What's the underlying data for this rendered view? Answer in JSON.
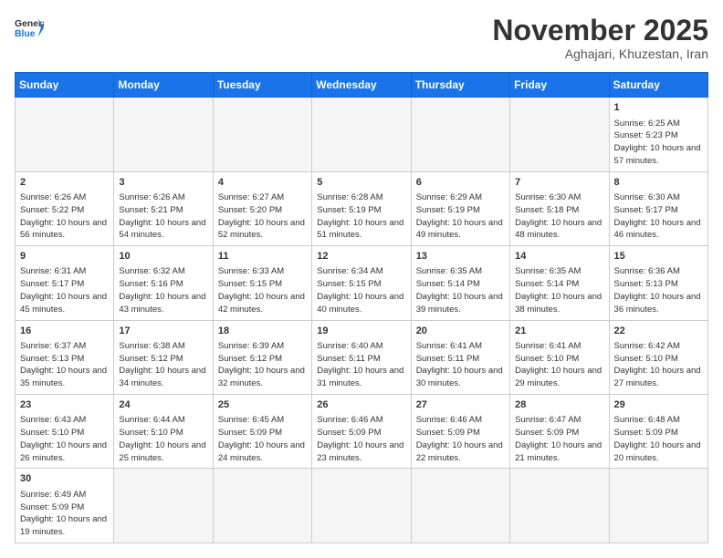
{
  "header": {
    "logo_general": "General",
    "logo_blue": "Blue",
    "month": "November 2025",
    "location": "Aghajari, Khuzestan, Iran"
  },
  "weekdays": [
    "Sunday",
    "Monday",
    "Tuesday",
    "Wednesday",
    "Thursday",
    "Friday",
    "Saturday"
  ],
  "rows": [
    [
      {
        "day": "",
        "info": ""
      },
      {
        "day": "",
        "info": ""
      },
      {
        "day": "",
        "info": ""
      },
      {
        "day": "",
        "info": ""
      },
      {
        "day": "",
        "info": ""
      },
      {
        "day": "",
        "info": ""
      },
      {
        "day": "1",
        "info": "Sunrise: 6:25 AM\nSunset: 5:23 PM\nDaylight: 10 hours\nand 57 minutes."
      }
    ],
    [
      {
        "day": "2",
        "info": "Sunrise: 6:26 AM\nSunset: 5:22 PM\nDaylight: 10 hours\nand 56 minutes."
      },
      {
        "day": "3",
        "info": "Sunrise: 6:26 AM\nSunset: 5:21 PM\nDaylight: 10 hours\nand 54 minutes."
      },
      {
        "day": "4",
        "info": "Sunrise: 6:27 AM\nSunset: 5:20 PM\nDaylight: 10 hours\nand 52 minutes."
      },
      {
        "day": "5",
        "info": "Sunrise: 6:28 AM\nSunset: 5:19 PM\nDaylight: 10 hours\nand 51 minutes."
      },
      {
        "day": "6",
        "info": "Sunrise: 6:29 AM\nSunset: 5:19 PM\nDaylight: 10 hours\nand 49 minutes."
      },
      {
        "day": "7",
        "info": "Sunrise: 6:30 AM\nSunset: 5:18 PM\nDaylight: 10 hours\nand 48 minutes."
      },
      {
        "day": "8",
        "info": "Sunrise: 6:30 AM\nSunset: 5:17 PM\nDaylight: 10 hours\nand 46 minutes."
      }
    ],
    [
      {
        "day": "9",
        "info": "Sunrise: 6:31 AM\nSunset: 5:17 PM\nDaylight: 10 hours\nand 45 minutes."
      },
      {
        "day": "10",
        "info": "Sunrise: 6:32 AM\nSunset: 5:16 PM\nDaylight: 10 hours\nand 43 minutes."
      },
      {
        "day": "11",
        "info": "Sunrise: 6:33 AM\nSunset: 5:15 PM\nDaylight: 10 hours\nand 42 minutes."
      },
      {
        "day": "12",
        "info": "Sunrise: 6:34 AM\nSunset: 5:15 PM\nDaylight: 10 hours\nand 40 minutes."
      },
      {
        "day": "13",
        "info": "Sunrise: 6:35 AM\nSunset: 5:14 PM\nDaylight: 10 hours\nand 39 minutes."
      },
      {
        "day": "14",
        "info": "Sunrise: 6:35 AM\nSunset: 5:14 PM\nDaylight: 10 hours\nand 38 minutes."
      },
      {
        "day": "15",
        "info": "Sunrise: 6:36 AM\nSunset: 5:13 PM\nDaylight: 10 hours\nand 36 minutes."
      }
    ],
    [
      {
        "day": "16",
        "info": "Sunrise: 6:37 AM\nSunset: 5:13 PM\nDaylight: 10 hours\nand 35 minutes."
      },
      {
        "day": "17",
        "info": "Sunrise: 6:38 AM\nSunset: 5:12 PM\nDaylight: 10 hours\nand 34 minutes."
      },
      {
        "day": "18",
        "info": "Sunrise: 6:39 AM\nSunset: 5:12 PM\nDaylight: 10 hours\nand 32 minutes."
      },
      {
        "day": "19",
        "info": "Sunrise: 6:40 AM\nSunset: 5:11 PM\nDaylight: 10 hours\nand 31 minutes."
      },
      {
        "day": "20",
        "info": "Sunrise: 6:41 AM\nSunset: 5:11 PM\nDaylight: 10 hours\nand 30 minutes."
      },
      {
        "day": "21",
        "info": "Sunrise: 6:41 AM\nSunset: 5:10 PM\nDaylight: 10 hours\nand 29 minutes."
      },
      {
        "day": "22",
        "info": "Sunrise: 6:42 AM\nSunset: 5:10 PM\nDaylight: 10 hours\nand 27 minutes."
      }
    ],
    [
      {
        "day": "23",
        "info": "Sunrise: 6:43 AM\nSunset: 5:10 PM\nDaylight: 10 hours\nand 26 minutes."
      },
      {
        "day": "24",
        "info": "Sunrise: 6:44 AM\nSunset: 5:10 PM\nDaylight: 10 hours\nand 25 minutes."
      },
      {
        "day": "25",
        "info": "Sunrise: 6:45 AM\nSunset: 5:09 PM\nDaylight: 10 hours\nand 24 minutes."
      },
      {
        "day": "26",
        "info": "Sunrise: 6:46 AM\nSunset: 5:09 PM\nDaylight: 10 hours\nand 23 minutes."
      },
      {
        "day": "27",
        "info": "Sunrise: 6:46 AM\nSunset: 5:09 PM\nDaylight: 10 hours\nand 22 minutes."
      },
      {
        "day": "28",
        "info": "Sunrise: 6:47 AM\nSunset: 5:09 PM\nDaylight: 10 hours\nand 21 minutes."
      },
      {
        "day": "29",
        "info": "Sunrise: 6:48 AM\nSunset: 5:09 PM\nDaylight: 10 hours\nand 20 minutes."
      }
    ],
    [
      {
        "day": "30",
        "info": "Sunrise: 6:49 AM\nSunset: 5:09 PM\nDaylight: 10 hours\nand 19 minutes."
      },
      {
        "day": "",
        "info": ""
      },
      {
        "day": "",
        "info": ""
      },
      {
        "day": "",
        "info": ""
      },
      {
        "day": "",
        "info": ""
      },
      {
        "day": "",
        "info": ""
      },
      {
        "day": "",
        "info": ""
      }
    ]
  ]
}
